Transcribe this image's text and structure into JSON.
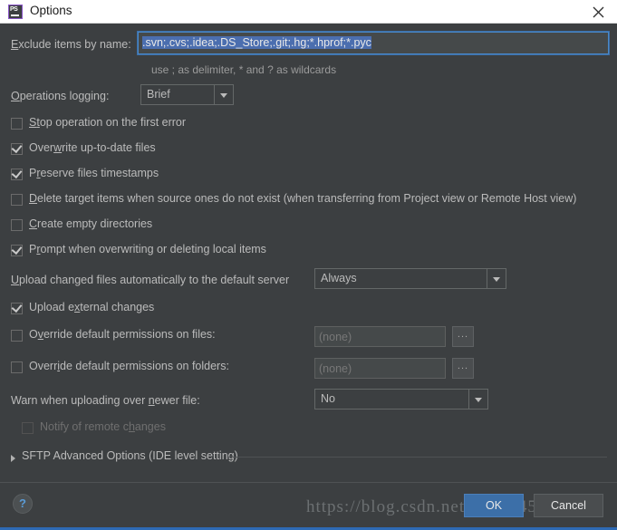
{
  "window": {
    "title": "Options",
    "app_icon": "phpstorm-ps-icon",
    "close_icon": "close-icon"
  },
  "exclude": {
    "label_prefix": "E",
    "label_rest": "xclude items by name:",
    "value": ".svn;.cvs;.idea;.DS_Store;.git;.hg;*.hprof;*.pyc",
    "hint": "use ; as delimiter, * and ? as wildcards"
  },
  "operations_logging": {
    "label_prefix": "O",
    "label_rest": "perations logging:",
    "value": "Brief"
  },
  "checkboxes": [
    {
      "id": "stop-operation-first-error",
      "pre": "S",
      "mid": "t",
      "post": "op operation on the first error",
      "checked": false,
      "enabled": true
    },
    {
      "id": "overwrite-up-to-date-files",
      "pre": "Over",
      "mid": "w",
      "post": "rite up-to-date files",
      "checked": true,
      "enabled": true
    },
    {
      "id": "preserve-files-timestamps",
      "pre": "P",
      "mid": "r",
      "post": "eserve files timestamps",
      "checked": true,
      "enabled": true
    },
    {
      "id": "delete-target-items",
      "pre": "",
      "mid": "D",
      "post": "elete target items when source ones do not exist (when transferring from Project view or Remote Host view)",
      "checked": false,
      "enabled": true
    },
    {
      "id": "create-empty-directories",
      "pre": "",
      "mid": "C",
      "post": "reate empty directories",
      "checked": false,
      "enabled": true
    },
    {
      "id": "prompt-when-overwriting",
      "pre": "P",
      "mid": "r",
      "post": "ompt when overwriting or deleting local items",
      "checked": true,
      "enabled": true
    }
  ],
  "upload_auto": {
    "label_prefix": "U",
    "label_rest": "pload changed files automatically to the default server",
    "value": "Always"
  },
  "upload_external": {
    "pre": "Upload e",
    "mid": "x",
    "post": "ternal changes",
    "checked": true
  },
  "permissions_files": {
    "pre": "O",
    "mid": "v",
    "post": "erride default permissions on files:",
    "checked": false,
    "value": "(none)",
    "browse_label": "..."
  },
  "permissions_folders": {
    "pre": "Overr",
    "mid": "i",
    "post": "de default permissions on folders:",
    "checked": false,
    "value": "(none)",
    "browse_label": "..."
  },
  "warn_newer": {
    "label_prefix": "Warn when uploading over ",
    "label_accel": "n",
    "label_rest": "ewer file:",
    "value": "No"
  },
  "notify_remote": {
    "pre": "Notify of remote c",
    "mid": "h",
    "post": "anges",
    "checked": false,
    "enabled": false
  },
  "sftp_section": {
    "title": "SFTP Advanced Options (IDE level setting)",
    "expanded": false,
    "chevron_icon": "chevron-right-icon"
  },
  "footer": {
    "help_icon": "help-question-icon",
    "ok_label": "OK",
    "cancel_label": "Cancel"
  },
  "watermark": {
    "text": "https://blog.csdn.net/qq_36451213"
  },
  "colors": {
    "background": "#3c3f41",
    "titlebar": "#ffffff",
    "text": "#bbbbbb",
    "accent_blue": "#3c6fa8",
    "selection_blue": "#4b6eaf",
    "focus_border": "#4a88c7",
    "bottom_edge": "#2d6ab4"
  }
}
